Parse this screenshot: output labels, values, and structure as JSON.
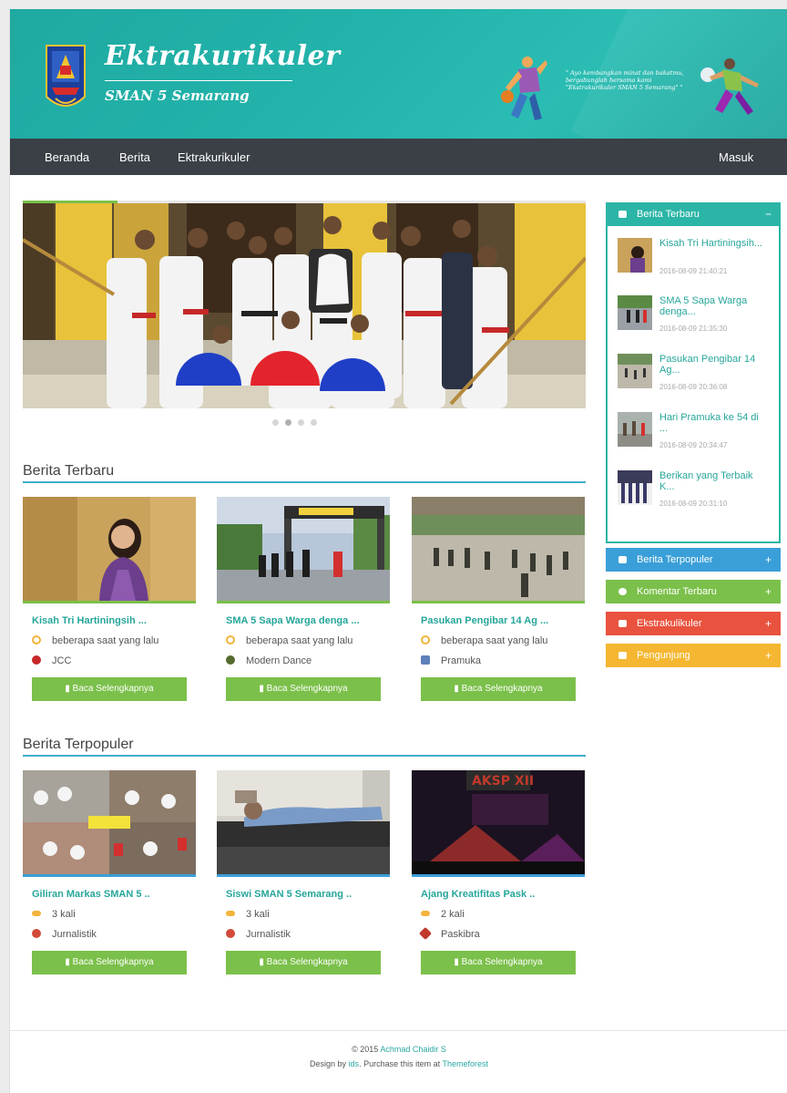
{
  "header": {
    "brand_title": "Ektrakurikuler",
    "brand_subtitle": "SMAN 5 Semarang",
    "quote": "\" Ayo kembangkan minat dan bakatmu, bergabunglah bersama kami \"Ekstrakurikuler SMAN 5 Semarang\" \""
  },
  "nav": {
    "items": [
      "Beranda",
      "Berita",
      "Ektrakurikuler"
    ],
    "login": "Masuk"
  },
  "slider": {
    "dots": 4,
    "active_dot": 1
  },
  "latest": {
    "title": "Berita Terbaru",
    "cards": [
      {
        "title": "Kisah Tri Hartiningsih  ...",
        "time": "beberapa saat yang lalu",
        "category": "JCC",
        "button": "Baca Selengkapnya"
      },
      {
        "title": "SMA 5 Sapa Warga denga  ...",
        "time": "beberapa saat yang lalu",
        "category": "Modern Dance",
        "button": "Baca Selengkapnya"
      },
      {
        "title": "Pasukan Pengibar 14 Ag  ...",
        "time": "beberapa saat yang lalu",
        "category": "Pramuka",
        "button": "Baca Selengkapnya"
      }
    ]
  },
  "popular": {
    "title": "Berita Terpopuler",
    "cards": [
      {
        "title": "Giliran Markas SMAN 5 ..",
        "views": "3 kali",
        "category": "Jurnalistik",
        "button": "Baca Selengkapnya"
      },
      {
        "title": "Siswi SMAN 5 Semarang ..",
        "views": "3 kali",
        "category": "Jurnalistik",
        "button": "Baca Selengkapnya"
      },
      {
        "title": "Ajang Kreatifitas Pask ..",
        "views": "2 kali",
        "category": "Paskibra",
        "button": "Baca Selengkapnya"
      }
    ]
  },
  "sidebar": {
    "latest_title": "Berita Terbaru",
    "latest_toggle": "−",
    "latest_items": [
      {
        "title": "Kisah Tri Hartiningsih...",
        "date": "2016-08-09 21:40:21"
      },
      {
        "title": "SMA 5 Sapa Warga denga...",
        "date": "2016-08-09 21:35:30"
      },
      {
        "title": "Pasukan Pengibar 14 Ag...",
        "date": "2016-08-09 20:36:08"
      },
      {
        "title": "Hari Pramuka ke 54 di ...",
        "date": "2016-08-09 20:34:47"
      },
      {
        "title": "Berikan yang Terbaik K...",
        "date": "2016-08-09 20:31:10"
      }
    ],
    "panels": [
      {
        "title": "Berita Terpopuler",
        "toggle": "+",
        "color": "#3a9fd8"
      },
      {
        "title": "Komentar Terbaru",
        "toggle": "+",
        "color": "#7bc04a"
      },
      {
        "title": "Ekstrakulikuler",
        "toggle": "+",
        "color": "#e9523e"
      },
      {
        "title": "Pengunjung",
        "toggle": "+",
        "color": "#f5b731"
      }
    ]
  },
  "footer": {
    "copyright": "© 2015",
    "author": "Achmad Chaidir S",
    "design_by": "Design by",
    "ids": "ids",
    "purchase": ". Purchase this item at",
    "themeforest": "Themeforest"
  },
  "colors": {
    "teal": "#22b3aa",
    "nav": "#3b4046",
    "green": "#7bc04a",
    "blue": "#3a9fd8",
    "red": "#e9523e",
    "yellow": "#f5b731"
  }
}
